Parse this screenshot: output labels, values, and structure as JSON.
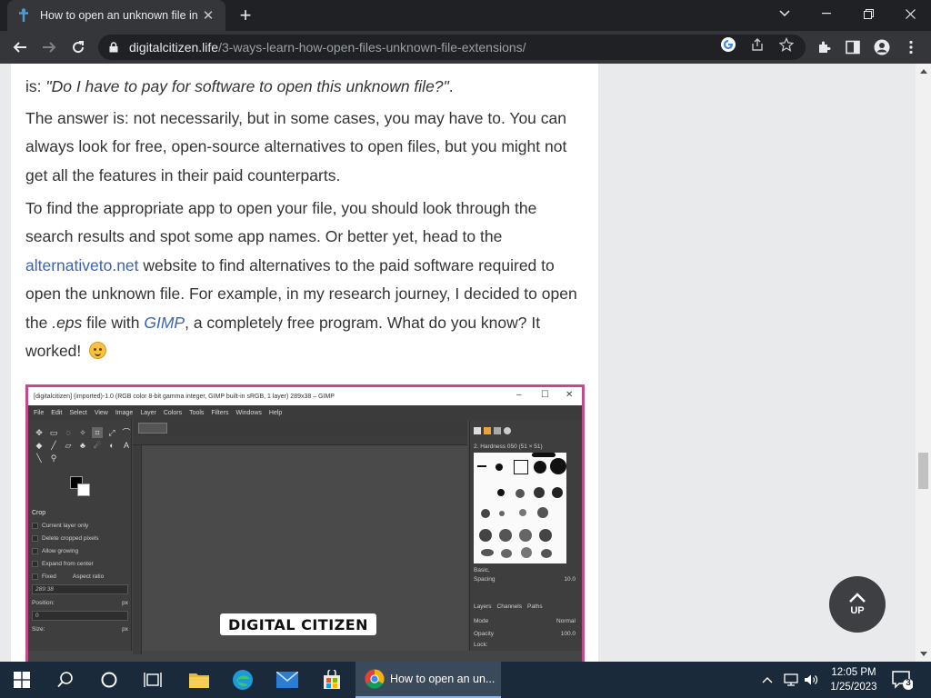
{
  "browser": {
    "tab_title": "How to open an unknown file in",
    "new_tab_label": "+",
    "url_host": "digitalcitizen.life",
    "url_path": "/3-ways-learn-how-open-files-unknown-file-extensions/"
  },
  "article": {
    "p1_prefix": "is: ",
    "p1_quote": "\"Do I have to pay for software to open this unknown file?\"",
    "p1_suffix": ".",
    "p2": "The answer is: not necessarily, but in some cases, you may have to. You can always look for free, open-source alternatives to open files, but you might not get all the features in their paid counterparts.",
    "p3_a": "To find the appropriate app to open your file, you should look through the search results and spot some app names. Or better yet, head to the ",
    "p3_link": "alternativeto.net",
    "p3_b": " website to find alternatives to the paid software required to open the unknown file. For example, in my research journey, I decided to open the ",
    "p3_ext": ".eps",
    "p3_c": " file with ",
    "p3_gimp": "GIMP",
    "p3_d": ", a completely free program. What do you know? It worked! "
  },
  "figure": {
    "title": "[digitalcitizen] (imported)-1.0 (RGB color 8-bit gamma integer, GIMP built-in sRGB, 1 layer) 289x38 – GIMP",
    "menu": [
      "File",
      "Edit",
      "Select",
      "View",
      "Image",
      "Layer",
      "Colors",
      "Tools",
      "Filters",
      "Windows",
      "Help"
    ],
    "tool_options_header": "Crop",
    "tool_options": [
      "Current layer only",
      "Delete cropped pixels",
      "Allow growing",
      "Expand from center"
    ],
    "fixed_label": "Fixed",
    "aspect_label": "Aspect ratio",
    "ratio_value": "289:38",
    "position_label": "Position:",
    "size_label": "Size:",
    "unit": "px",
    "brush_header": "2. Hardness 050 (51 × 51)",
    "brush_tag": "Basic,",
    "spacing_label": "Spacing",
    "spacing_value": "10.0",
    "dock_tabs": [
      "Layers",
      "Channels",
      "Paths"
    ],
    "mode_label": "Mode",
    "mode_value": "Normal",
    "opacity_label": "Opacity",
    "opacity_value": "100.0",
    "lock_label": "Lock:",
    "logo_text": "DIGITAL CITIZEN"
  },
  "up_button": {
    "label": "UP"
  },
  "taskbar": {
    "chrome_task_label": "How to open an un...",
    "time": "12:05 PM",
    "date": "1/25/2023",
    "notification_count": "3"
  },
  "colors": {
    "link": "#3a63b8",
    "figure_border": "#c44a8e",
    "taskbar": "#1b2a3a"
  }
}
